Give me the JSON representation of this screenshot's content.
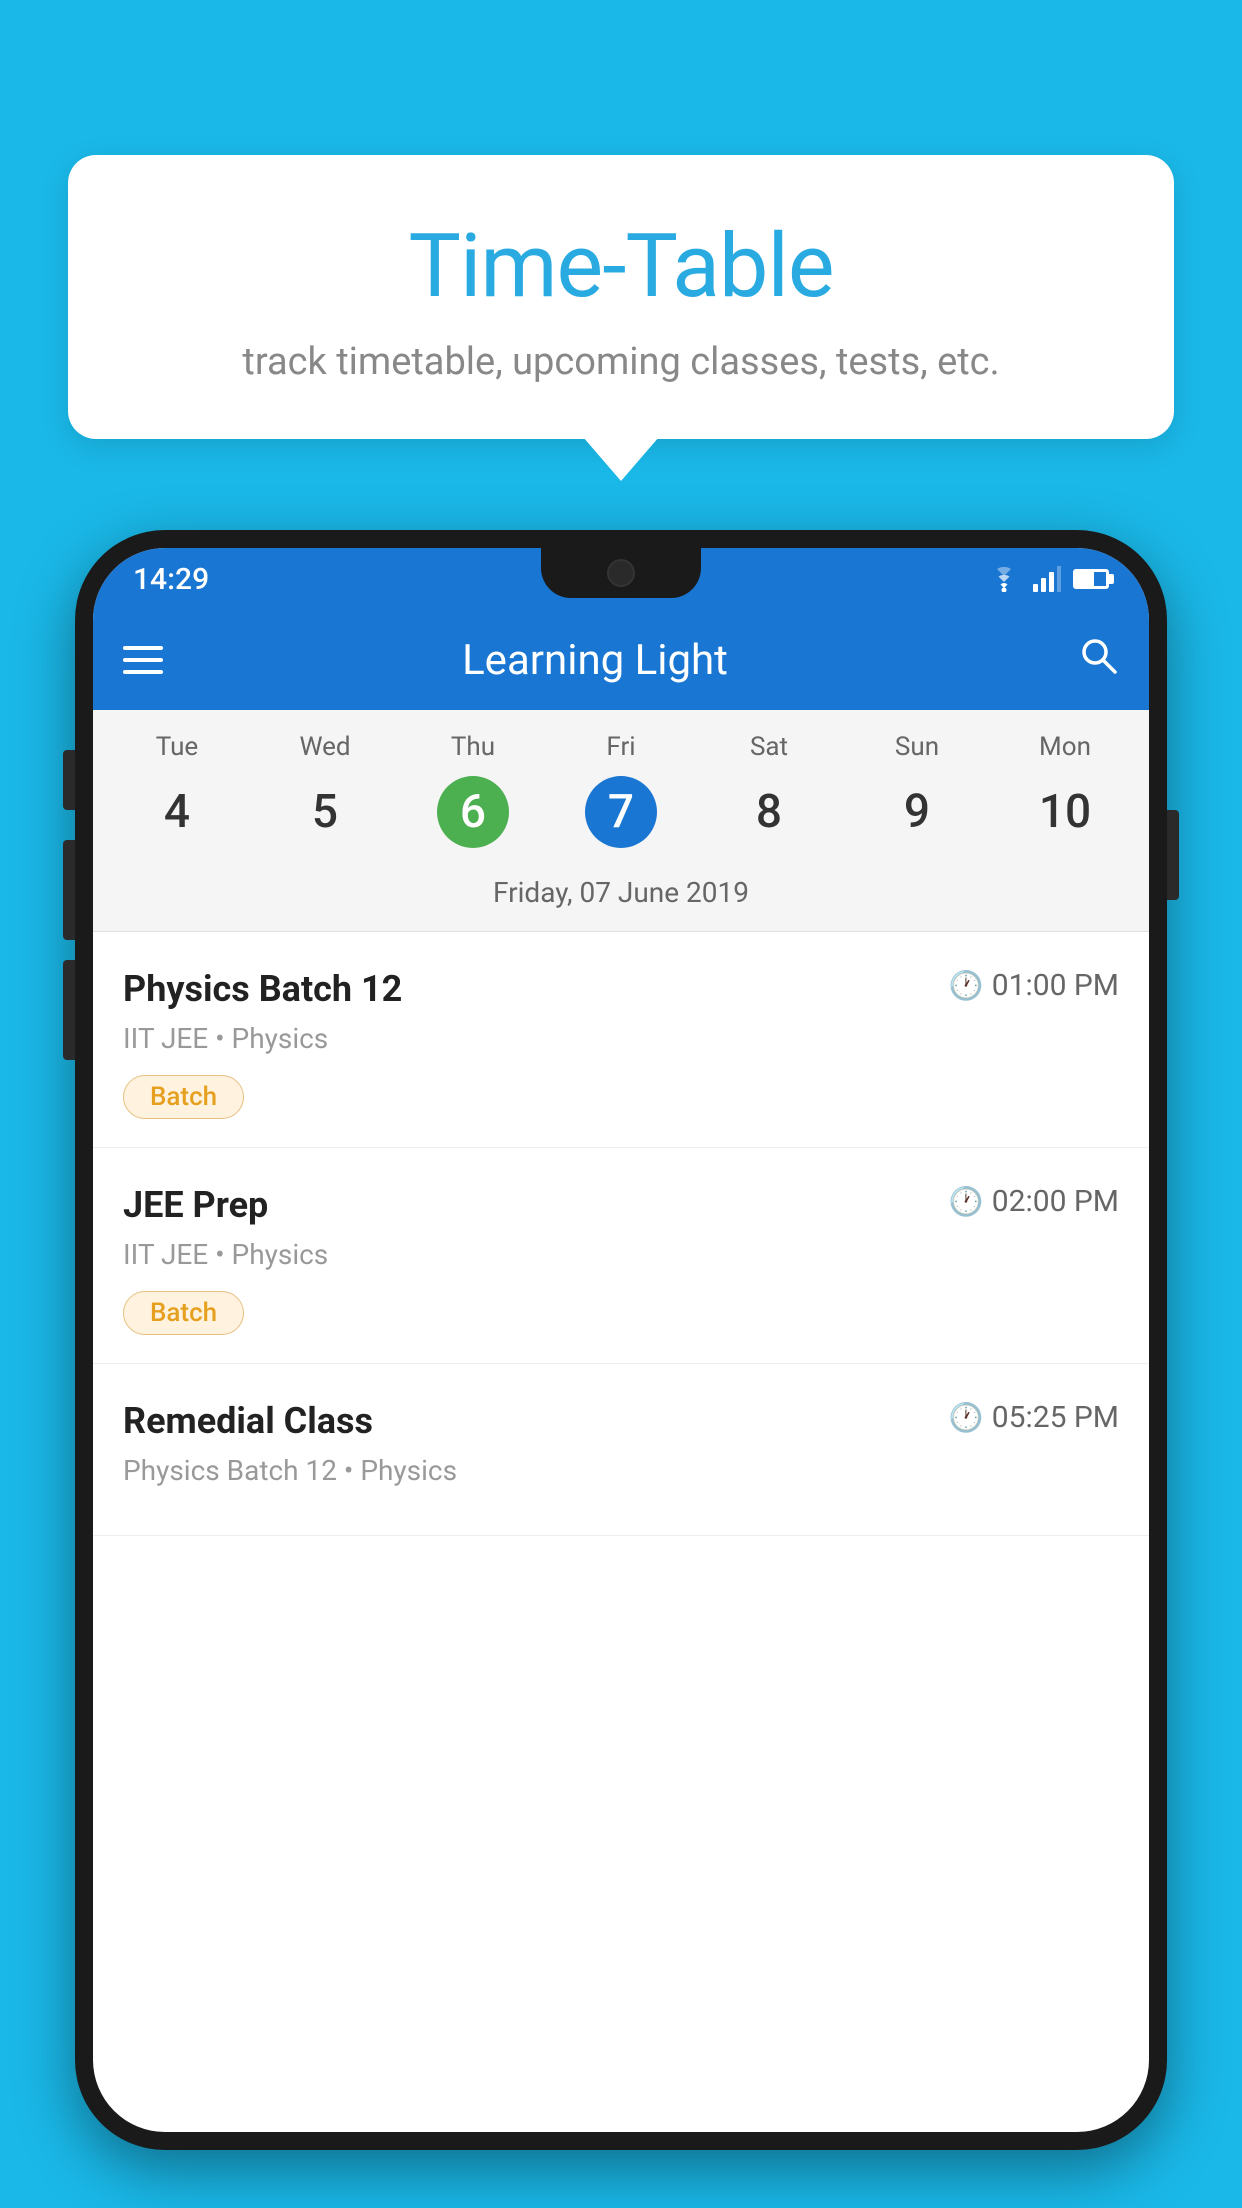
{
  "background_color": "#1ab8e8",
  "tooltip": {
    "title": "Time-Table",
    "subtitle": "track timetable, upcoming classes, tests, etc."
  },
  "phone": {
    "status_bar": {
      "time": "14:29"
    },
    "app_bar": {
      "title": "Learning Light"
    },
    "calendar": {
      "days": [
        {
          "name": "Tue",
          "number": "4",
          "state": "normal"
        },
        {
          "name": "Wed",
          "number": "5",
          "state": "normal"
        },
        {
          "name": "Thu",
          "number": "6",
          "state": "today"
        },
        {
          "name": "Fri",
          "number": "7",
          "state": "selected"
        },
        {
          "name": "Sat",
          "number": "8",
          "state": "normal"
        },
        {
          "name": "Sun",
          "number": "9",
          "state": "normal"
        },
        {
          "name": "Mon",
          "number": "10",
          "state": "normal"
        }
      ],
      "selected_date_label": "Friday, 07 June 2019"
    },
    "schedule": [
      {
        "title": "Physics Batch 12",
        "time": "01:00 PM",
        "subtitle": "IIT JEE • Physics",
        "tag": "Batch"
      },
      {
        "title": "JEE Prep",
        "time": "02:00 PM",
        "subtitle": "IIT JEE • Physics",
        "tag": "Batch"
      },
      {
        "title": "Remedial Class",
        "time": "05:25 PM",
        "subtitle": "Physics Batch 12 • Physics",
        "tag": null
      }
    ]
  }
}
